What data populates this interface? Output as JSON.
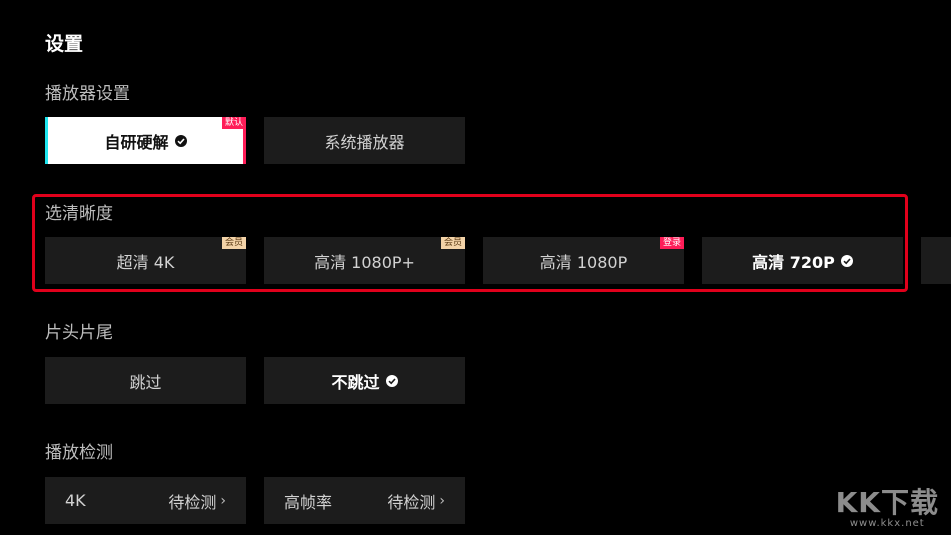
{
  "page": {
    "title": "设置"
  },
  "player": {
    "label": "播放器设置",
    "options": [
      {
        "label": "自研硬解",
        "badge": "默认"
      },
      {
        "label": "系统播放器"
      }
    ]
  },
  "resolution": {
    "label": "选清晰度",
    "options": [
      {
        "label": "超清 4K",
        "badge": "会员"
      },
      {
        "label": "高清 1080P+",
        "badge": "会员"
      },
      {
        "label": "高清 1080P",
        "badge": "登录"
      },
      {
        "label": "高清 720P"
      }
    ]
  },
  "intro_outro": {
    "label": "片头片尾",
    "options": [
      {
        "label": "跳过"
      },
      {
        "label": "不跳过"
      }
    ]
  },
  "detection": {
    "label": "播放检测",
    "items": [
      {
        "name": "4K",
        "status": "待检测"
      },
      {
        "name": "高帧率",
        "status": "待检测"
      }
    ]
  },
  "watermark": {
    "logo": "KK下载",
    "url": "www.kkx.net"
  },
  "colors": {
    "accent_pink": "#ff1d58",
    "accent_cyan": "#20e6f0",
    "highlight_red": "#e0001b",
    "vip_badge": "#f3d3a8"
  }
}
